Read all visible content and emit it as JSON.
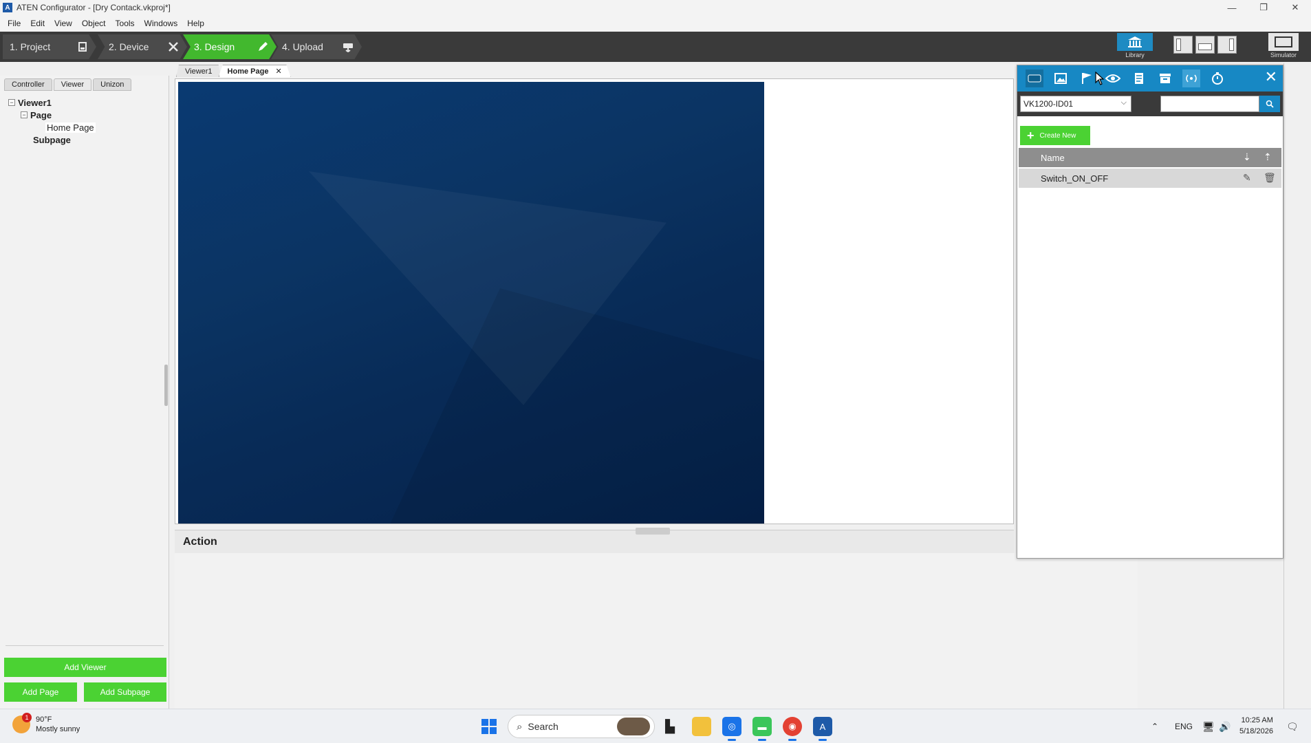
{
  "window": {
    "title": "ATEN Configurator - [Dry Contack.vkproj*]",
    "logo_letter": "A",
    "minimize": "—",
    "maximize": "❐",
    "close": "✕"
  },
  "menu": [
    "File",
    "Edit",
    "View",
    "Object",
    "Tools",
    "Windows",
    "Help"
  ],
  "steps": [
    {
      "label": "1. Project",
      "icon": "document-icon"
    },
    {
      "label": "2. Device",
      "icon": "tools-icon"
    },
    {
      "label": "3. Design",
      "icon": "pencil-icon"
    },
    {
      "label": "4. Upload",
      "icon": "upload-icon"
    }
  ],
  "toolbar_right": {
    "library_label": "Library",
    "simulator_label": "Simulator"
  },
  "left_panel": {
    "tabs": [
      "Controller",
      "Viewer",
      "Unizon"
    ],
    "active_tab": "Viewer",
    "tree": {
      "root": "Viewer1",
      "page": "Page",
      "home_page": "Home Page",
      "subpage": "Subpage",
      "expand_minus": "−"
    },
    "buttons": {
      "add_viewer": "Add Viewer",
      "add_page": "Add Page",
      "add_subpage": "Add Subpage"
    }
  },
  "doc_tabs": {
    "viewer": "Viewer1",
    "home": "Home Page",
    "close": "✕"
  },
  "action": {
    "title": "Action"
  },
  "library": {
    "device": "VK1200-ID01",
    "search_placeholder": "",
    "create_new": "Create New",
    "list_header": "Name",
    "items": [
      "Switch_ON_OFF"
    ],
    "close": "✕",
    "accent": "#1788c4",
    "green": "#4bd233"
  },
  "taskbar": {
    "weather_temp": "90°F",
    "weather_desc": "Mostly sunny",
    "weather_badge": "1",
    "search_label": "Search",
    "lang": "ENG",
    "time": "10:25 AM",
    "date": "5/18/2026"
  }
}
